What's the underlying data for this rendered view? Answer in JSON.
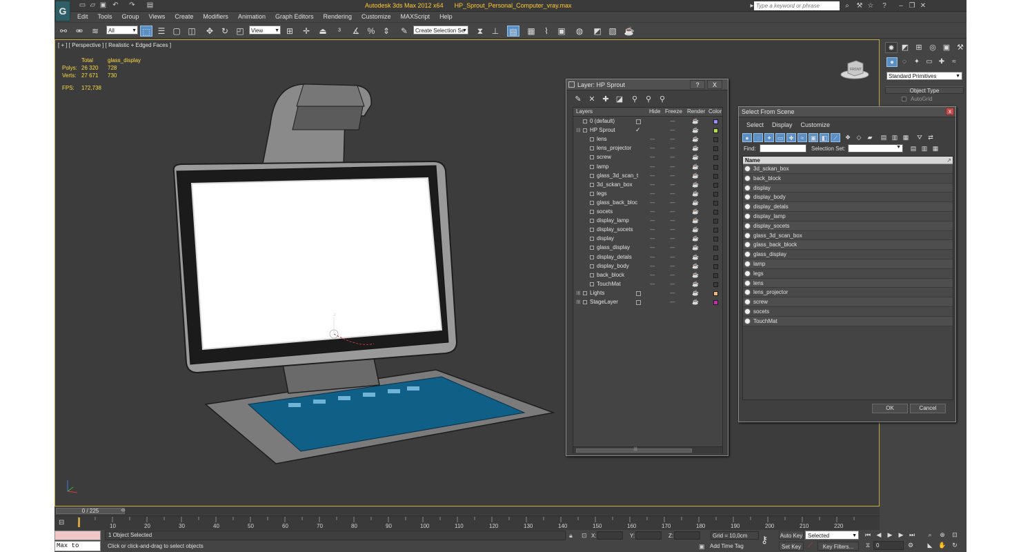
{
  "titlebar": {
    "app_title": "Autodesk 3ds Max  2012 x64",
    "file_name": "HP_Sprout_Personal_Computer_vray.max",
    "search_placeholder": "Type a keyword or phrase"
  },
  "menu": [
    "Edit",
    "Tools",
    "Group",
    "Views",
    "Create",
    "Modifiers",
    "Animation",
    "Graph Editors",
    "Rendering",
    "Customize",
    "MAXScript",
    "Help"
  ],
  "toolbar": {
    "selection_filter": "All",
    "ref_coord": "View",
    "named_selection": "Create Selection Se"
  },
  "viewport": {
    "label": "[ + ] [ Perspective ] [ Realistic + Edged Faces ]",
    "stats": {
      "header_total": "Total",
      "header_object": "glass_display",
      "polys_label": "Polys:",
      "polys_total": "26 320",
      "polys_object": "728",
      "verts_label": "Verts:",
      "verts_total": "27 671",
      "verts_object": "730",
      "fps_label": "FPS:",
      "fps_value": "172,738"
    },
    "viewcube_label": "FRONT",
    "gizmo_label": "z"
  },
  "command_panel": {
    "category": "Standard Primitives",
    "rollout_title": "Object Type",
    "autogrid": "AutoGrid"
  },
  "layer_dialog": {
    "title": "Layer: HP Sprout",
    "help": "?",
    "close": "X",
    "columns": {
      "layers": "Layers",
      "hide": "Hide",
      "freeze": "Freeze",
      "render": "Render",
      "color": "Color"
    },
    "rows": [
      {
        "name": "0 (default)",
        "level": 0,
        "expander": "",
        "hide": "box",
        "color": "#9a8cff"
      },
      {
        "name": "HP Sprout",
        "level": 0,
        "expander": "⊟",
        "hide": "tick",
        "color": "#b6e04a"
      },
      {
        "name": "lens",
        "level": 1,
        "expander": "",
        "hide": "dash",
        "color": "#3a3a3a"
      },
      {
        "name": "lens_projector",
        "level": 1,
        "expander": "",
        "hide": "dash",
        "color": "#3a3a3a"
      },
      {
        "name": "screw",
        "level": 1,
        "expander": "",
        "hide": "dash",
        "color": "#3a3a3a"
      },
      {
        "name": "lamp",
        "level": 1,
        "expander": "",
        "hide": "dash",
        "color": "#3a3a3a"
      },
      {
        "name": "glass_3d_scan_t",
        "level": 1,
        "expander": "",
        "hide": "dash",
        "color": "#3a3a3a"
      },
      {
        "name": "3d_sckan_box",
        "level": 1,
        "expander": "",
        "hide": "dash",
        "color": "#3a3a3a"
      },
      {
        "name": "legs",
        "level": 1,
        "expander": "",
        "hide": "dash",
        "color": "#3a3a3a"
      },
      {
        "name": "glass_back_bloc",
        "level": 1,
        "expander": "",
        "hide": "dash",
        "color": "#3a3a3a"
      },
      {
        "name": "socets",
        "level": 1,
        "expander": "",
        "hide": "dash",
        "color": "#3a3a3a"
      },
      {
        "name": "display_lamp",
        "level": 1,
        "expander": "",
        "hide": "dash",
        "color": "#3a3a3a"
      },
      {
        "name": "display_socets",
        "level": 1,
        "expander": "",
        "hide": "dash",
        "color": "#3a3a3a"
      },
      {
        "name": "display",
        "level": 1,
        "expander": "",
        "hide": "dash",
        "color": "#3a3a3a"
      },
      {
        "name": "glass_display",
        "level": 1,
        "expander": "",
        "hide": "dash",
        "color": "#3a3a3a"
      },
      {
        "name": "display_detals",
        "level": 1,
        "expander": "",
        "hide": "dash",
        "color": "#3a3a3a"
      },
      {
        "name": "display_body",
        "level": 1,
        "expander": "",
        "hide": "dash",
        "color": "#3a3a3a"
      },
      {
        "name": "back_block",
        "level": 1,
        "expander": "",
        "hide": "dash",
        "color": "#3a3a3a"
      },
      {
        "name": "TouchMat",
        "level": 1,
        "expander": "",
        "hide": "dash",
        "color": "#3a3a3a"
      },
      {
        "name": "Lights",
        "level": 0,
        "expander": "⊞",
        "hide": "box",
        "color": "#f0b87a"
      },
      {
        "name": "StageLayer",
        "level": 0,
        "expander": "⊞",
        "hide": "box",
        "color": "#c82ab4"
      }
    ]
  },
  "select_from_scene": {
    "title": "Select From Scene",
    "close": "x",
    "menu": [
      "Select",
      "Display",
      "Customize"
    ],
    "find_label": "Find:",
    "selection_set_label": "Selection Set:",
    "column_name": "Name",
    "objects": [
      "3d_sckan_box",
      "back_block",
      "display",
      "display_body",
      "display_detals",
      "display_lamp",
      "display_socets",
      "glass_3d_scan_box",
      "glass_back_block",
      "glass_display",
      "lamp",
      "legs",
      "lens",
      "lens_projector",
      "screw",
      "socets",
      "TouchMat"
    ],
    "ok": "OK",
    "cancel": "Cancel"
  },
  "timeline": {
    "frame_display": "0 / 225",
    "ticks": [
      "10",
      "20",
      "30",
      "40",
      "50",
      "60",
      "70",
      "80",
      "90",
      "100",
      "110",
      "120",
      "130",
      "140",
      "150",
      "160",
      "170",
      "180",
      "190",
      "200",
      "210",
      "220"
    ]
  },
  "status": {
    "listener_input": "Max to Physc",
    "selection": "1 Object Selected",
    "prompt": "Click or click-and-drag to select objects",
    "x_label": "X:",
    "y_label": "Y:",
    "z_label": "Z:",
    "grid": "Grid = 10,0cm",
    "add_time_tag": "Add Time Tag",
    "auto_key": "Auto Key",
    "set_key": "Set Key",
    "key_mode": "Selected",
    "key_filters": "Key Filters...",
    "current_frame": "0"
  }
}
